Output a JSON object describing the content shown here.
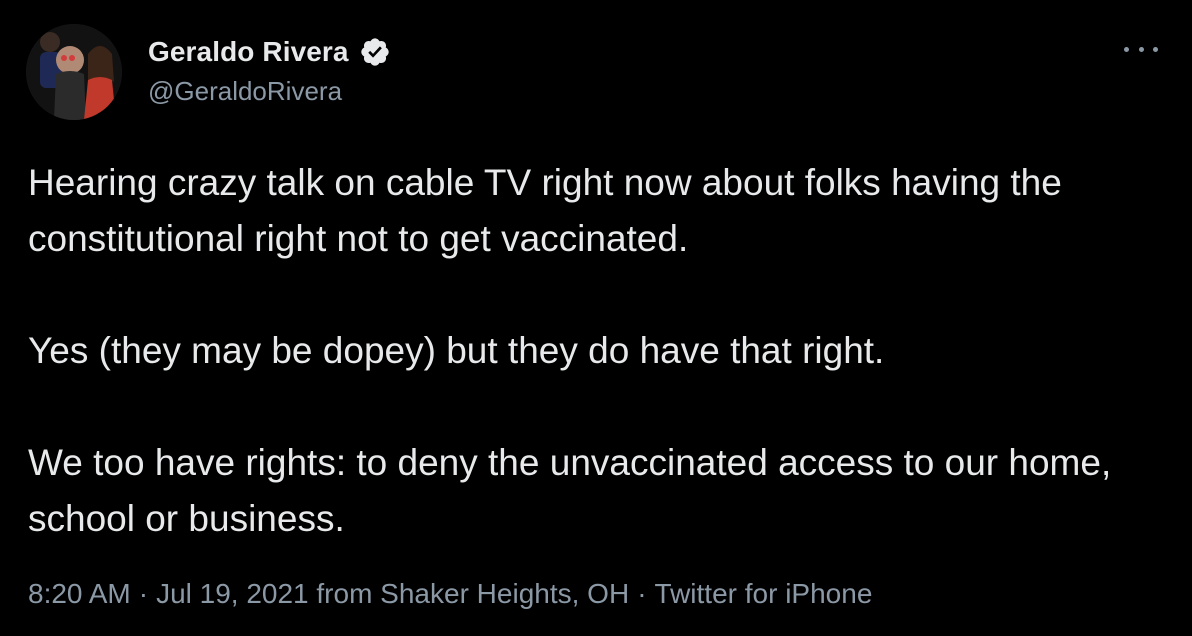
{
  "author": {
    "display_name": "Geraldo Rivera",
    "handle": "@GeraldoRivera",
    "verified": true,
    "avatar_icon": "profile-photo"
  },
  "tweet": {
    "paragraphs": [
      "Hearing crazy talk on cable TV right now about folks having the constitutional right not to get vaccinated.",
      "Yes (they may be dopey) but they do have that right.",
      "We too have rights: to deny the unvaccinated access to our home, school or business."
    ]
  },
  "meta": {
    "time": "8:20 AM",
    "separator": "·",
    "date_location": "Jul 19, 2021 from Shaker Heights, OH",
    "source": "Twitter for iPhone"
  },
  "colors": {
    "background": "#000000",
    "text": "#e7e9ea",
    "secondary": "#8b98a5",
    "verified_badge": "#e7e9ea"
  },
  "icons": {
    "more": "more-horizontal-icon",
    "verified": "verified-badge-icon"
  }
}
